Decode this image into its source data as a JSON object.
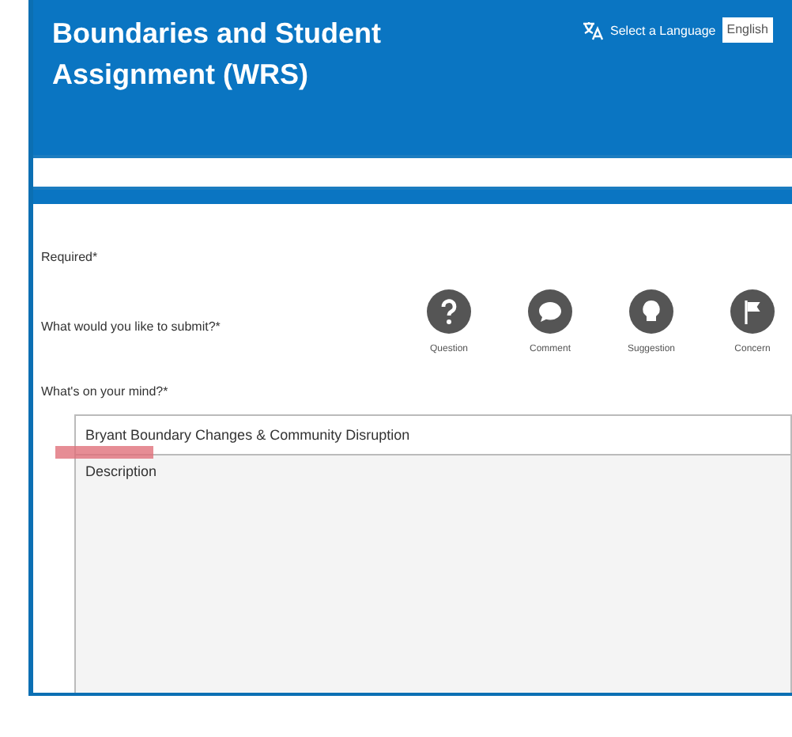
{
  "header": {
    "title": "Boundaries and Student Assignment (WRS)",
    "language_label": "Select a Language",
    "language_value": "English"
  },
  "form": {
    "required_note": "Required*",
    "submit_type_label": "What would you like to submit?*",
    "submit_types": [
      {
        "kind": "question",
        "label": "Question"
      },
      {
        "kind": "comment",
        "label": "Comment"
      },
      {
        "kind": "suggestion",
        "label": "Suggestion"
      },
      {
        "kind": "concern",
        "label": "Concern"
      }
    ],
    "mind_label": "What's on your mind?*",
    "title_value": "Bryant Boundary Changes & Community Disruption",
    "description_placeholder": "Description"
  }
}
